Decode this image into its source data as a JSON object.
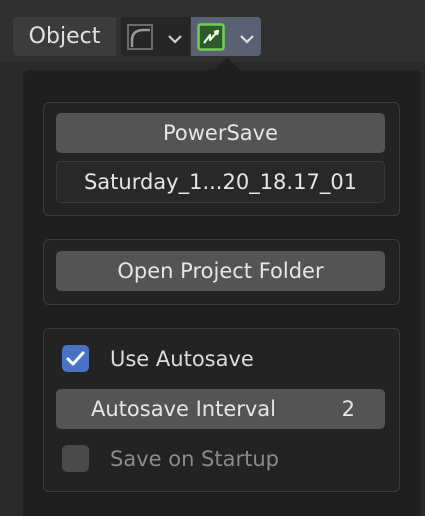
{
  "header": {
    "object_label": "Object",
    "curve_selector_icon": "curve-icon",
    "powersave_selector_icon": "powersave-icon"
  },
  "popup": {
    "powersave_button": "PowerSave",
    "filename_value": "Saturday_1...20_18.17_01",
    "open_folder_button": "Open Project Folder",
    "use_autosave": {
      "label": "Use Autosave",
      "checked": true
    },
    "autosave_interval": {
      "label": "Autosave Interval",
      "value": "2"
    },
    "save_on_startup": {
      "label": "Save on Startup",
      "checked": false
    }
  },
  "colors": {
    "accent_checkbox": "#4a72c4",
    "powersave_icon_green": "#6fcf55",
    "active_selector_bg": "#5a6172"
  }
}
